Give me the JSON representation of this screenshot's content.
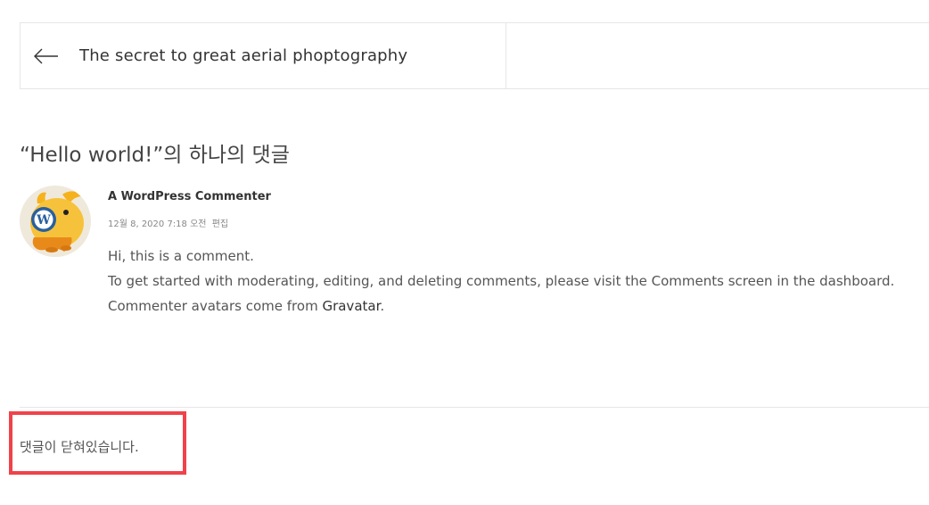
{
  "post_navigation": {
    "prev_title": "The secret to great aerial phoptography"
  },
  "comments": {
    "title": "“Hello world!”의 하나의 댓글",
    "items": [
      {
        "author": "A WordPress Commenter",
        "date": "12월 8, 2020 7:18 오전",
        "edit_label": "편집",
        "lines": {
          "l1": "Hi, this is a comment.",
          "l2": "To get started with moderating, editing, and deleting comments, please visit the Comments screen in the dashboard.",
          "l3_prefix": "Commenter avatars come from ",
          "l3_link": "Gravatar",
          "l3_suffix": "."
        }
      }
    ]
  },
  "comments_closed": {
    "text": "댓글이 닫혀있습니다."
  },
  "colors": {
    "highlight_border": "#f0424a",
    "divider": "#e6e6e6"
  }
}
